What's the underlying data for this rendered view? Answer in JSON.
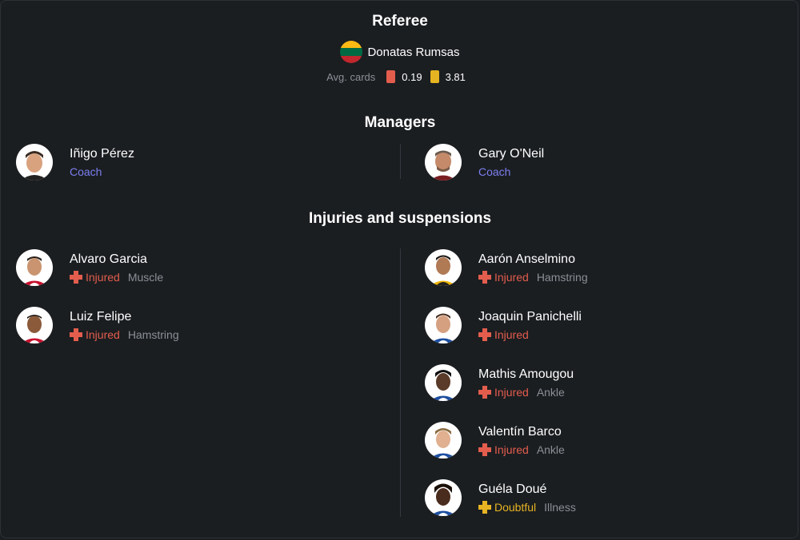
{
  "colors": {
    "injured": "#e35d4d",
    "doubtful": "#e6b422",
    "coach": "#7b7ff0",
    "red_card": "#e35d4d",
    "yellow_card": "#e6b422"
  },
  "referee": {
    "title": "Referee",
    "name": "Donatas Rumsas",
    "flag_icon": "lithuania-flag-icon",
    "avg_label": "Avg. cards",
    "red_avg": "0.19",
    "yellow_avg": "3.81"
  },
  "managers": {
    "title": "Managers",
    "home": {
      "name": "Iñigo Pérez",
      "role": "Coach"
    },
    "away": {
      "name": "Gary O'Neil",
      "role": "Coach"
    }
  },
  "injuries": {
    "title": "Injuries and suspensions",
    "home": [
      {
        "name": "Alvaro Garcia",
        "status": "Injured",
        "reason": "Muscle"
      },
      {
        "name": "Luiz Felipe",
        "status": "Injured",
        "reason": "Hamstring"
      }
    ],
    "away": [
      {
        "name": "Aarón Anselmino",
        "status": "Injured",
        "reason": "Hamstring"
      },
      {
        "name": "Joaquin Panichelli",
        "status": "Injured",
        "reason": ""
      },
      {
        "name": "Mathis Amougou",
        "status": "Injured",
        "reason": "Ankle"
      },
      {
        "name": "Valentín Barco",
        "status": "Injured",
        "reason": "Ankle"
      },
      {
        "name": "Guéla Doué",
        "status": "Doubtful",
        "reason": "Illness"
      }
    ]
  }
}
